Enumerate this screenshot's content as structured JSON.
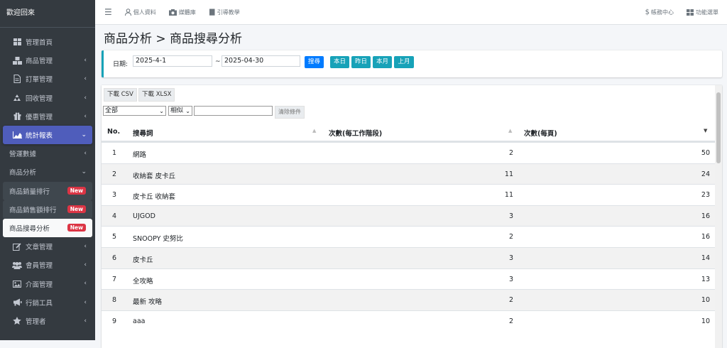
{
  "sidebar": {
    "brand": "歡迎回來",
    "items": [
      {
        "label": "管理首頁",
        "icon": "dashboard-icon",
        "chevron": ""
      },
      {
        "label": "商品管理",
        "icon": "cubes-icon",
        "chevron": "‹"
      },
      {
        "label": "訂單管理",
        "icon": "file-icon",
        "chevron": "‹"
      },
      {
        "label": "回收管理",
        "icon": "recycle-icon",
        "chevron": "‹"
      },
      {
        "label": "優惠管理",
        "icon": "gift-icon",
        "chevron": "‹"
      },
      {
        "label": "統計報表",
        "icon": "chart-area-icon",
        "chevron": "⌄"
      },
      {
        "label": "營運數據",
        "chevron": "‹"
      },
      {
        "label": "商品分析",
        "chevron": "⌄"
      },
      {
        "label": "商品銷量排行",
        "badge": "New"
      },
      {
        "label": "商品銷售額排行",
        "badge": "New"
      },
      {
        "label": "商品搜尋分析",
        "badge": "New"
      },
      {
        "label": "文章管理",
        "icon": "edit-icon",
        "chevron": "‹"
      },
      {
        "label": "會員管理",
        "icon": "users-icon",
        "chevron": "‹"
      },
      {
        "label": "介面管理",
        "icon": "image-icon",
        "chevron": "‹"
      },
      {
        "label": "行銷工具",
        "icon": "bullhorn-icon",
        "chevron": "‹"
      },
      {
        "label": "管理者",
        "icon": "star-icon",
        "chevron": "‹"
      }
    ]
  },
  "topbar": {
    "menu_icon": "☰",
    "profile": "個人資料",
    "media": "媒體庫",
    "guide": "引導教學",
    "billing": "帳務中心",
    "features": "功能選單"
  },
  "page_title": "商品分析 > 商品搜尋分析",
  "filter": {
    "date_label": "日期:",
    "start_date": "2025-4-1",
    "separator": "~",
    "end_date": "2025-04-30",
    "search_btn": "搜尋",
    "today_btn": "本日",
    "yesterday_btn": "昨日",
    "this_month_btn": "本月",
    "last_month_btn": "上月"
  },
  "table_tools": {
    "csv_btn": "下載 CSV",
    "xlsx_btn": "下載 XLSX",
    "field_select": "全部",
    "match_select": "相似",
    "clear_btn": "清除條件"
  },
  "table": {
    "headers": [
      "No.",
      "搜尋詞",
      "次數(每工作階段)",
      "次數(每頁)"
    ],
    "rows": [
      [
        "1",
        "網路",
        "2",
        "50"
      ],
      [
        "2",
        "收納套 皮卡丘",
        "11",
        "24"
      ],
      [
        "3",
        "皮卡丘 收納套",
        "11",
        "23"
      ],
      [
        "4",
        "UJGOD",
        "3",
        "16"
      ],
      [
        "5",
        "SNOOPY 史努比",
        "2",
        "16"
      ],
      [
        "6",
        "皮卡丘",
        "3",
        "14"
      ],
      [
        "7",
        "全攻略",
        "3",
        "13"
      ],
      [
        "8",
        "最新 攻略",
        "2",
        "10"
      ],
      [
        "9",
        "aaa",
        "2",
        "10"
      ]
    ]
  }
}
